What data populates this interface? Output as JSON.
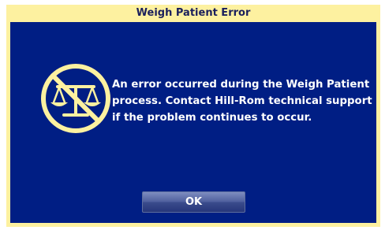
{
  "dialog": {
    "title": "Weigh Patient Error",
    "message": "An error occurred during the Weigh Patient\nprocess. Contact Hill-Rom technical support\nif the problem continues to occur.",
    "icon": "no-scale-icon",
    "ok_label": "OK"
  },
  "colors": {
    "frame": "#fdf1a0",
    "body": "#001e84",
    "title_text": "#1a1f5c",
    "icon_stroke": "#fdf1a0",
    "message_text": "#ffffff"
  }
}
